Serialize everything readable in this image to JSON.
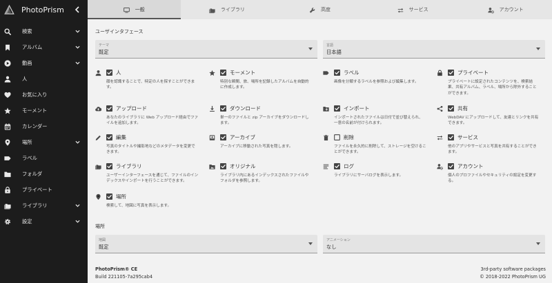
{
  "app": {
    "title": "PhotoPrism"
  },
  "sidebar": {
    "items": [
      {
        "label": "検索",
        "icon": "search-icon",
        "expand": true
      },
      {
        "label": "アルバム",
        "icon": "bookmark-icon",
        "expand": true
      },
      {
        "label": "動画",
        "icon": "play-circle-icon",
        "expand": true
      },
      {
        "label": "人",
        "icon": "person-icon",
        "expand": false
      },
      {
        "label": "お気に入り",
        "icon": "heart-icon",
        "expand": false
      },
      {
        "label": "モーメント",
        "icon": "star-icon",
        "expand": false
      },
      {
        "label": "カレンダー",
        "icon": "calendar-icon",
        "expand": false
      },
      {
        "label": "場所",
        "icon": "location-icon",
        "expand": true
      },
      {
        "label": "ラベル",
        "icon": "label-icon",
        "expand": false
      },
      {
        "label": "フォルダ",
        "icon": "folder-icon",
        "expand": false
      },
      {
        "label": "プライベート",
        "icon": "lock-icon",
        "expand": false
      },
      {
        "label": "ライブラリ",
        "icon": "library-folder-icon",
        "expand": true
      },
      {
        "label": "設定",
        "icon": "gear-icon",
        "expand": true
      }
    ]
  },
  "tabs": [
    {
      "label": "一般",
      "icon": "monitor-icon",
      "active": true
    },
    {
      "label": "ライブラリ",
      "icon": "library-folder-icon",
      "active": false
    },
    {
      "label": "高度",
      "icon": "wrench-icon",
      "active": false
    },
    {
      "label": "サービス",
      "icon": "swap-icon",
      "active": false
    },
    {
      "label": "アカウント",
      "icon": "account-cog-icon",
      "active": false
    }
  ],
  "ui_section": {
    "title": "ユーザインタフェース",
    "theme": {
      "label": "テーマ",
      "value": "既定"
    },
    "language": {
      "label": "言語",
      "value": "日本語"
    }
  },
  "features": [
    {
      "name": "人",
      "icon": "person-icon",
      "checked": true,
      "desc": "顔を認識することで、特定の人を探すことができます。"
    },
    {
      "name": "モーメント",
      "icon": "star-icon",
      "checked": true,
      "desc": "特別な瞬間、旅、場所を記録したアルバムを自動的に作成します。"
    },
    {
      "name": "ラベル",
      "icon": "label-icon",
      "checked": true,
      "desc": "画像を分類するラベルを参照および編集します。"
    },
    {
      "name": "プライベート",
      "icon": "lock-icon",
      "checked": true,
      "desc": "プライベートに設定されたコンテンツを、検索結果、共有アルバム、ラベル、場所から除外することができます。"
    },
    {
      "name": "アップロード",
      "icon": "cloud-upload-icon",
      "checked": true,
      "desc": "あなたのライブラリに Web アップロード経由でファイルを追加します。"
    },
    {
      "name": "ダウンロード",
      "icon": "download-icon",
      "checked": true,
      "desc": "単一のファイルと zip アーカイブをダウンロードします。"
    },
    {
      "name": "インポート",
      "icon": "folder-plus-icon",
      "checked": true,
      "desc": "インポートされたファイルは日付で並び替えられ、一意の名前が付けられます。"
    },
    {
      "name": "共有",
      "icon": "share-icon",
      "checked": true,
      "desc": "WebDAV にアップロードして、友達とリンクを共有できます。"
    },
    {
      "name": "編集",
      "icon": "pencil-icon",
      "checked": true,
      "desc": "写真のタイトルや撮影地などのメタデータを変更できます。"
    },
    {
      "name": "アーカイブ",
      "icon": "archive-icon",
      "checked": true,
      "desc": "アーカイブに移動された写真を隠します。"
    },
    {
      "name": "削除",
      "icon": "trash-icon",
      "checked": false,
      "desc": "ファイルを永久的に削除して、ストレージを空けることができます。"
    },
    {
      "name": "サービス",
      "icon": "swap-icon",
      "checked": true,
      "desc": "他のアプリやサービスと写真を共有することができます。"
    },
    {
      "name": "ライブラリ",
      "icon": "library-folder-icon",
      "checked": true,
      "desc": "ユーザーインターフェースを通じて、ファイルのインデックスやインポートを行うことができます。"
    },
    {
      "name": "オリジナル",
      "icon": "folder-image-icon",
      "checked": true,
      "desc": "ライブラリ内にあるインデックスされたファイルやフォルダを参照します。"
    },
    {
      "name": "ログ",
      "icon": "logs-icon",
      "checked": true,
      "desc": "ライブラリにサーバログを表示します。"
    },
    {
      "name": "アカウント",
      "icon": "account-cog-icon",
      "checked": true,
      "desc": "個人のプロファイルやセキュリティの設定を変更する。"
    },
    {
      "name": "場所",
      "icon": "location-icon",
      "checked": true,
      "desc": "検索して、地図に写真を表示します。"
    }
  ],
  "places_section": {
    "title": "場所",
    "map": {
      "label": "地図",
      "value": "既定"
    },
    "animation": {
      "label": "アニメーション",
      "value": "なし"
    }
  },
  "footer": {
    "product": "PhotoPrism® CE",
    "build": "Build 221105-7a295cab4",
    "third_party": "3rd-party software packages",
    "copyright": "© 2018-2022 PhotoPrism UG"
  },
  "colors": {
    "sidebar_bg": "#1c1c1c",
    "content_bg": "#f2f2f2",
    "tabbar_bg": "#e6e6e6"
  }
}
